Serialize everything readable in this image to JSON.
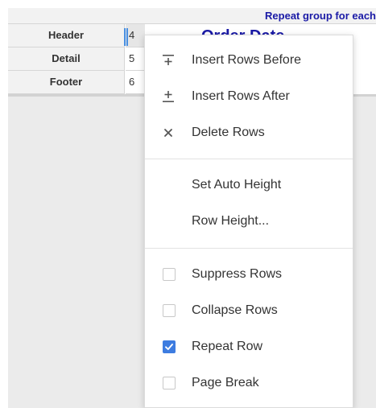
{
  "grid": {
    "group_header": "Repeat group for each",
    "rows": [
      {
        "label": "Header",
        "number": "4"
      },
      {
        "label": "Detail",
        "number": "5"
      },
      {
        "label": "Footer",
        "number": "6"
      }
    ],
    "cell_text": "Order Date"
  },
  "menu": {
    "items": [
      {
        "icon": "insert-rows-before-icon",
        "label": "Insert Rows Before"
      },
      {
        "icon": "insert-rows-after-icon",
        "label": "Insert Rows After"
      },
      {
        "icon": "delete-icon",
        "label": "Delete Rows"
      },
      {
        "icon": "",
        "label": "Set Auto Height"
      },
      {
        "icon": "",
        "label": "Row Height..."
      },
      {
        "icon": "checkbox",
        "label": "Suppress Rows",
        "checked": false
      },
      {
        "icon": "checkbox",
        "label": "Collapse Rows",
        "checked": false
      },
      {
        "icon": "checkbox",
        "label": "Repeat Row",
        "checked": true
      },
      {
        "icon": "checkbox",
        "label": "Page Break",
        "checked": false
      }
    ]
  },
  "colors": {
    "accent": "#3d7ce0",
    "header_text": "#1a1aa6"
  }
}
